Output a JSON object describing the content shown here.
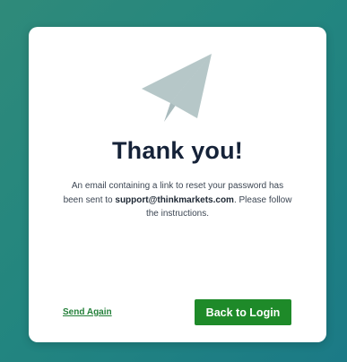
{
  "dialog": {
    "icon": "paper-plane-icon",
    "title": "Thank you!",
    "message_before": "An email containing a link to reset your password has been sent to ",
    "email": "support@thinkmarkets.com",
    "message_after": ". Please follow the instructions.",
    "send_again_label": "Send Again",
    "back_to_login_label": "Back to Login"
  },
  "colors": {
    "background_gradient": [
      "#2f8a7a",
      "#1b7a86"
    ],
    "card": "#ffffff",
    "title": "#152238",
    "icon": "#b6c7c8",
    "primary_button": "#1e8a29",
    "link": "#24803a"
  }
}
